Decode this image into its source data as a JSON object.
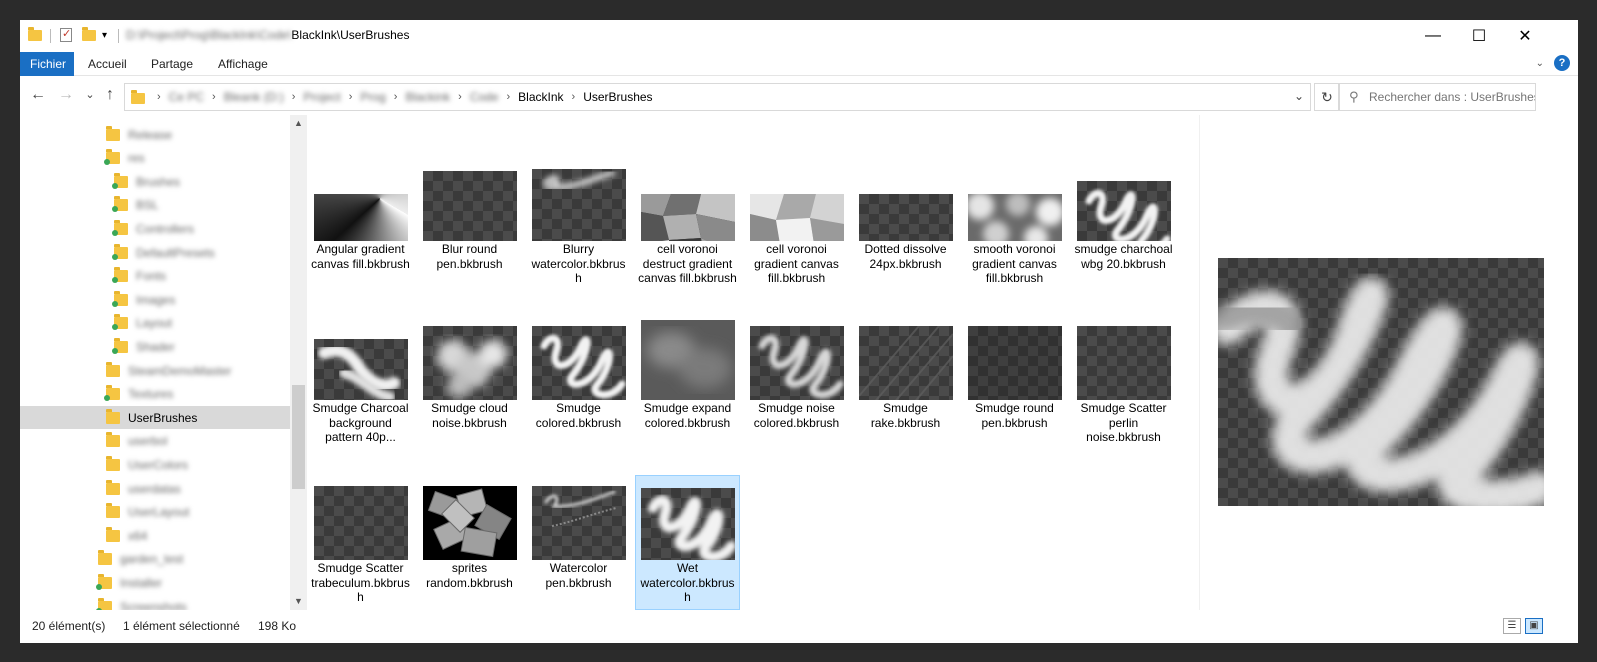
{
  "titlebar": {
    "path_blurred": "D:\\Project\\Prog\\BlackInk\\Code\\",
    "path_visible": "BlackInk\\UserBrushes",
    "minimize": "—",
    "maximize": "☐",
    "close": "✕"
  },
  "ribbon": {
    "tabs": [
      "Fichier",
      "Accueil",
      "Partage",
      "Affichage"
    ],
    "help": "?",
    "collapse": "⌄"
  },
  "nav": {
    "back": "←",
    "forward": "→",
    "recent": "⌄",
    "up": "↑",
    "breadcrumbs": [
      "Ce PC",
      "Bleank (D:)",
      "Project",
      "Prog",
      "Blackink",
      "Code",
      "BlackInk",
      "UserBrushes"
    ],
    "refresh": "↻",
    "dropdown": "⌄"
  },
  "search": {
    "placeholder": "Rechercher dans : UserBrushes",
    "icon": "search-icon"
  },
  "tree": {
    "items": [
      {
        "label": "Release",
        "depth": 1,
        "blurred": true
      },
      {
        "label": "res",
        "depth": 1,
        "blurred": true,
        "green": true
      },
      {
        "label": "Brushes",
        "depth": 2,
        "blurred": true,
        "green": true
      },
      {
        "label": "BSL",
        "depth": 2,
        "blurred": true,
        "green": true
      },
      {
        "label": "Controllers",
        "depth": 2,
        "blurred": true,
        "green": true
      },
      {
        "label": "DefaultPresets",
        "depth": 2,
        "blurred": true,
        "green": true
      },
      {
        "label": "Fonts",
        "depth": 2,
        "blurred": true,
        "green": true
      },
      {
        "label": "Images",
        "depth": 2,
        "blurred": true,
        "green": true
      },
      {
        "label": "Layout",
        "depth": 2,
        "blurred": true,
        "green": true
      },
      {
        "label": "Shader",
        "depth": 2,
        "blurred": true,
        "green": true
      },
      {
        "label": "SteamDemoMaster",
        "depth": 1,
        "blurred": true
      },
      {
        "label": "Textures",
        "depth": 1,
        "blurred": true,
        "green": true
      },
      {
        "label": "UserBrushes",
        "depth": 1,
        "blurred": false,
        "selected": true
      },
      {
        "label": "userbol",
        "depth": 1,
        "blurred": true
      },
      {
        "label": "UserColors",
        "depth": 1,
        "blurred": true
      },
      {
        "label": "userdatas",
        "depth": 1,
        "blurred": true
      },
      {
        "label": "UserLayout",
        "depth": 1,
        "blurred": true
      },
      {
        "label": "x64",
        "depth": 1,
        "blurred": true
      },
      {
        "label": "garden_test",
        "depth": 0,
        "blurred": true
      },
      {
        "label": "Installer",
        "depth": 0,
        "blurred": true,
        "green": true
      },
      {
        "label": "Screenshots",
        "depth": 0,
        "blurred": true,
        "green": true
      }
    ]
  },
  "files": [
    {
      "name": "Angular gradient canvas fill.bkbrush",
      "thumb": "angular"
    },
    {
      "name": "Blur round pen.bkbrush",
      "thumb": "checker"
    },
    {
      "name": "Blurry watercolor.bkbrush",
      "thumb": "blurry"
    },
    {
      "name": "cell voronoi destruct gradient canvas fill.bkbrush",
      "thumb": "voronoi-dark"
    },
    {
      "name": "cell voronoi gradient canvas fill.bkbrush",
      "thumb": "voronoi-light"
    },
    {
      "name": "Dotted dissolve 24px.bkbrush",
      "thumb": "checker"
    },
    {
      "name": "smooth voronoi gradient canvas fill.bkbrush",
      "thumb": "smooth-voronoi"
    },
    {
      "name": "smudge charchoal wbg 20.bkbrush",
      "thumb": "scribble"
    },
    {
      "name": "Smudge Charcoal background pattern 40p...",
      "thumb": "charcoal"
    },
    {
      "name": "Smudge cloud noise.bkbrush",
      "thumb": "cloud"
    },
    {
      "name": "Smudge colored.bkbrush",
      "thumb": "scribble-bright"
    },
    {
      "name": "Smudge expand colored.bkbrush",
      "thumb": "expand"
    },
    {
      "name": "Smudge noise colored.bkbrush",
      "thumb": "noise-scribble"
    },
    {
      "name": "Smudge rake.bkbrush",
      "thumb": "rake"
    },
    {
      "name": "Smudge round pen.bkbrush",
      "thumb": "checker-dim"
    },
    {
      "name": "Smudge Scatter perlin noise.bkbrush",
      "thumb": "checker"
    },
    {
      "name": "Smudge Scatter trabeculum.bkbrush",
      "thumb": "checker"
    },
    {
      "name": "sprites random.bkbrush",
      "thumb": "sprites"
    },
    {
      "name": "Watercolor pen.bkbrush",
      "thumb": "watercolor-pen"
    },
    {
      "name": "Wet watercolor.bkbrush",
      "thumb": "wet",
      "selected": true
    }
  ],
  "status": {
    "count": "20 élément(s)",
    "selected": "1 élément sélectionné",
    "size": "198 Ko"
  }
}
